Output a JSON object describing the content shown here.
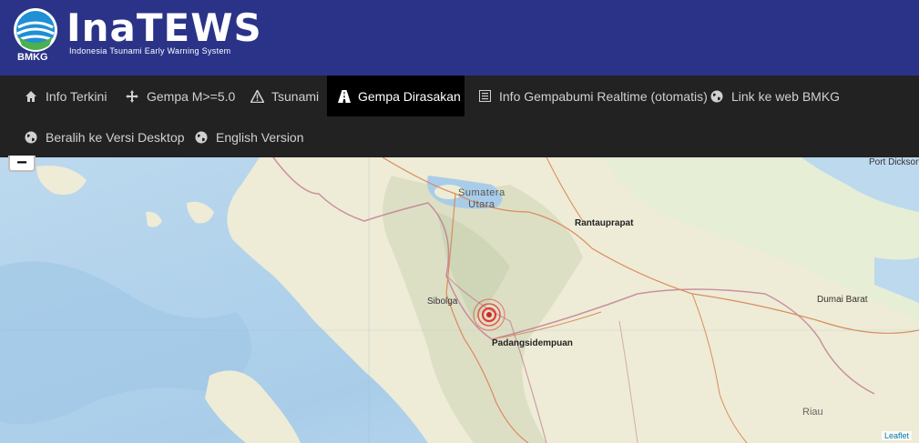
{
  "header": {
    "logo_title": "InaTEWS",
    "logo_subtitle": "Indonesia Tsunami Early Warning System",
    "logo_org": "BMKG"
  },
  "nav": {
    "items": [
      {
        "label": "Info Terkini",
        "icon": "home-icon"
      },
      {
        "label": "Gempa M>=5.0",
        "icon": "move-icon"
      },
      {
        "label": "Tsunami",
        "icon": "warning-icon"
      },
      {
        "label": "Gempa Dirasakan",
        "icon": "road-icon",
        "active": true
      },
      {
        "label": "Info Gempabumi Realtime (otomatis)",
        "icon": "list-icon"
      },
      {
        "label": "Link ke web BMKG",
        "icon": "globe-icon"
      },
      {
        "label": "Beralih ke Versi Desktop",
        "icon": "globe-icon"
      },
      {
        "label": "English Version",
        "icon": "globe-icon"
      }
    ]
  },
  "map": {
    "zoom_out": "−",
    "labels": {
      "region": "Sumatera\nUtara",
      "city1": "Rantauprapat",
      "city2": "Sibolga",
      "city3": "Padangsidempuan",
      "city4": "Dumai Barat",
      "city5": "Port Dickson",
      "city6": "Riau"
    },
    "attribution": "Leaflet",
    "epicenter_color": "#e53935"
  }
}
